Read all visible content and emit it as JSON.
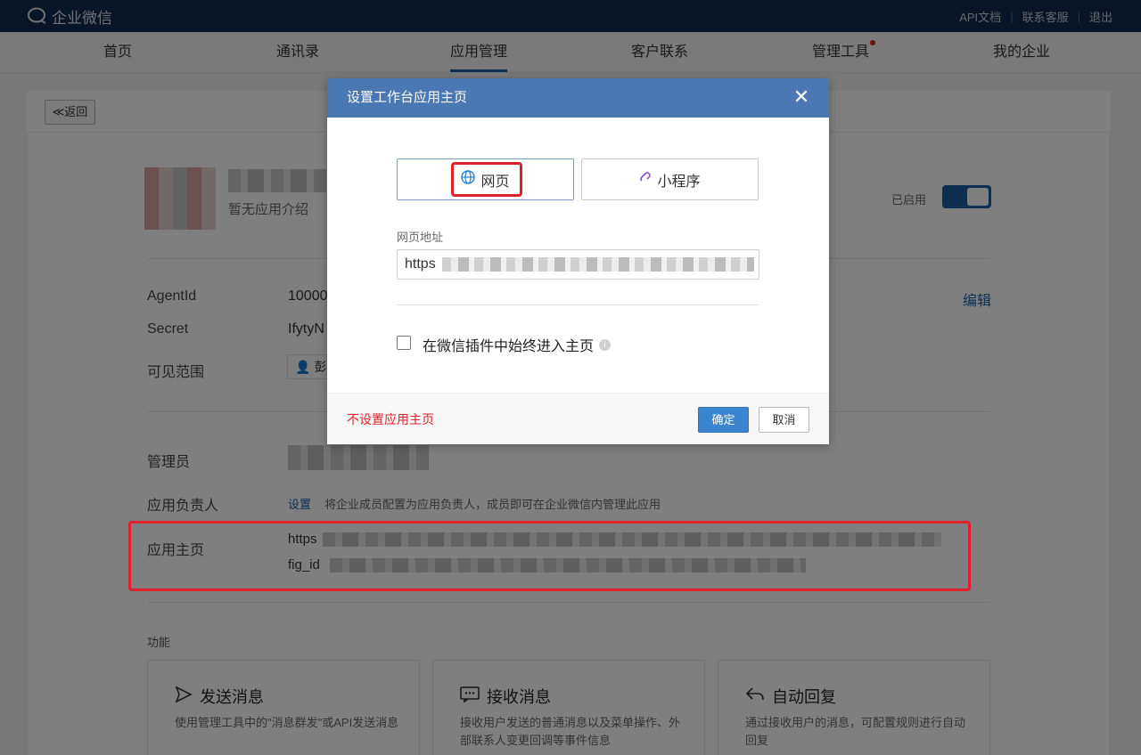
{
  "topbar": {
    "logo_text": "企业微信",
    "links": [
      "API文档",
      "联系客服",
      "退出"
    ]
  },
  "nav": {
    "tabs": [
      {
        "label": "首页"
      },
      {
        "label": "通讯录"
      },
      {
        "label": "应用管理"
      },
      {
        "label": "客户联系"
      },
      {
        "label": "管理工具"
      },
      {
        "label": "我的企业"
      }
    ],
    "active": "应用管理"
  },
  "detail": {
    "back_label": "≪返回",
    "app_desc": "暂无应用介绍",
    "status_label": "已启用",
    "agentid_label": "AgentId",
    "agentid_value": "10000",
    "secret_label": "Secret",
    "secret_value": "IfytyN",
    "visible_label": "可见范围",
    "visible_value": "彭",
    "edit_label": "编辑",
    "admin_label": "管理员",
    "owner_label": "应用负责人",
    "owner_link": "设置",
    "owner_desc": "将企业成员配置为应用负责人，成员即可在企业微信内管理此应用",
    "home_label": "应用主页",
    "home_url_prefix": "https",
    "home_extra_prefix": "fig_id",
    "functions_label": "功能",
    "features": [
      {
        "title": "发送消息",
        "desc": "使用管理工具中的\"消息群发\"或API发送消息",
        "icon": "send-icon"
      },
      {
        "title": "接收消息",
        "desc": "接收用户发送的普通消息以及菜单操作、外部联系人变更回调等事件信息",
        "icon": "message-icon"
      },
      {
        "title": "自动回复",
        "desc": "通过接收用户的消息，可配置规则进行自动回复",
        "icon": "reply-icon"
      }
    ]
  },
  "modal": {
    "title": "设置工作台应用主页",
    "options": [
      {
        "label": "网页",
        "icon": "globe-icon",
        "selected": true
      },
      {
        "label": "小程序",
        "icon": "mini-program-icon",
        "selected": false
      }
    ],
    "url_label": "网页地址",
    "url_value": "https",
    "checkbox_label": "在微信插件中始终进入主页",
    "checkbox_checked": false,
    "no_home_label": "不设置应用主页",
    "ok_label": "确定",
    "cancel_label": "取消"
  },
  "colors": {
    "topbar": "#0d2b4e",
    "accent": "#1f5fa0",
    "modal_header": "#4a78b2",
    "danger": "#e0202a"
  }
}
